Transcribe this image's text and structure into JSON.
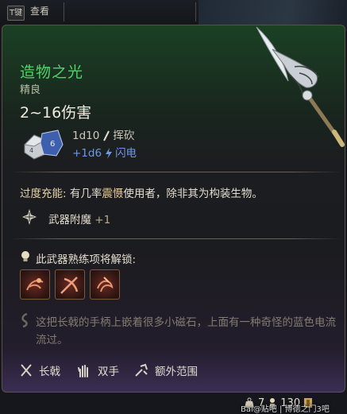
{
  "topbar": {
    "key": "T键",
    "view_label": "查看"
  },
  "item": {
    "name": "造物之光",
    "rarity": "精良",
    "damage_total": "2~16伤害",
    "damage_lines": [
      {
        "dice": "1d10",
        "type": "挥砍",
        "icon": "slash-icon"
      },
      {
        "dice": "+1d6",
        "type": "闪电",
        "icon": "lightning-icon"
      }
    ]
  },
  "passive": {
    "name": "过度充能:",
    "text_before": " 有几率",
    "keyword": "震慑",
    "text_after": "使用者，除非其为构装生物。"
  },
  "enchant": {
    "label": "武器附魔",
    "bonus": "+1"
  },
  "proficiency": {
    "title": "此武器熟练项将解锁:",
    "actions": [
      "action-1",
      "action-2",
      "action-3"
    ]
  },
  "flavor": "这把长戟的手柄上嵌着很多小磁石，上面有一种奇怪的蓝色电流流过。",
  "properties": [
    {
      "label": "长戟",
      "icon": "halberd-icon"
    },
    {
      "label": "双手",
      "icon": "two-handed-icon"
    },
    {
      "label": "额外范围",
      "icon": "reach-icon"
    }
  ],
  "footer": {
    "weight": "7",
    "price": "130"
  },
  "watermark": "Bai@贴吧 | 博德之门3吧",
  "colors": {
    "name": "#4fd36a",
    "lightning": "#6f97e6",
    "keyword": "#e7c98f",
    "flavor": "#837c72"
  }
}
